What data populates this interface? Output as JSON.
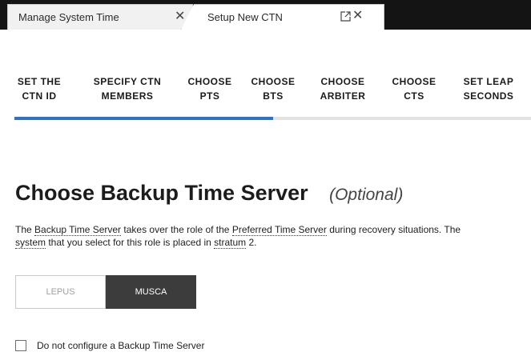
{
  "tabs": [
    {
      "label": "Manage System Time",
      "close_icon": "close-icon"
    },
    {
      "label": "Setup New CTN",
      "popout_icon": "popout-icon",
      "close_icon": "close-icon"
    }
  ],
  "wizard": {
    "steps": [
      {
        "line1": "SET THE",
        "line2": "CTN ID",
        "state": "done"
      },
      {
        "line1": "SPECIFY CTN",
        "line2": "MEMBERS",
        "state": "done"
      },
      {
        "line1": "CHOOSE",
        "line2": "PTS",
        "state": "done"
      },
      {
        "line1": "CHOOSE",
        "line2": "BTS",
        "state": "current"
      },
      {
        "line1": "CHOOSE",
        "line2": "ARBITER",
        "state": "todo"
      },
      {
        "line1": "CHOOSE",
        "line2": "CTS",
        "state": "todo"
      },
      {
        "line1": "SET LEAP",
        "line2": "SECONDS",
        "state": "todo"
      }
    ],
    "progress_fraction": 0.5
  },
  "page": {
    "title": "Choose Backup Time Server",
    "optional_label": "(Optional)",
    "description": {
      "p1": "The ",
      "t1": "Backup Time Server",
      "p2": " takes over the role of the ",
      "t2": "Preferred Time Server",
      "p3": " during recovery situations. The ",
      "t3": "system",
      "p4": " that you select for this role is placed in ",
      "t4": "stratum",
      "p5": " 2."
    }
  },
  "server_options": [
    {
      "label": "LEPUS",
      "selected": false
    },
    {
      "label": "MUSCA",
      "selected": true
    }
  ],
  "checkbox": {
    "label": "Do not configure a Backup Time Server",
    "checked": false
  },
  "colors": {
    "accent": "#2f71c6",
    "tab_bar": "#141414",
    "selected_button": "#3c3c3c",
    "inactive_step": "#a8a8a8"
  }
}
